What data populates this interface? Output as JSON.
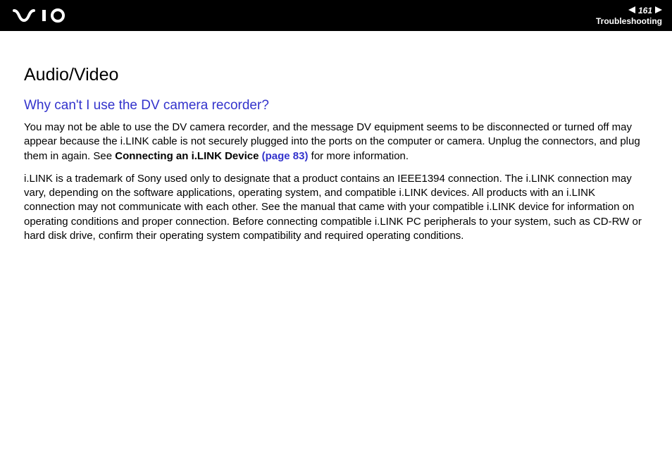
{
  "header": {
    "logo_alt": "VAIO",
    "page_number": "161",
    "section": "Troubleshooting"
  },
  "content": {
    "section_title": "Audio/Video",
    "question": "Why can't I use the DV camera recorder?",
    "p1_a": "You may not be able to use the DV camera recorder, and the message DV equipment seems to be disconnected or turned off may appear because the i.LINK cable is not securely plugged into the ports on the computer or camera. Unplug the connectors, and plug them in again. See ",
    "p1_xref_bold": "Connecting an i.LINK Device",
    "p1_xref_link": " (page 83)",
    "p1_b": " for more information.",
    "p2": "i.LINK is a trademark of Sony used only to designate that a product contains an IEEE1394 connection. The i.LINK connection may vary, depending on the software applications, operating system, and compatible i.LINK devices. All products with an i.LINK connection may not communicate with each other. See the manual that came with your compatible i.LINK device for information on operating conditions and proper connection. Before connecting compatible i.LINK PC peripherals to your system, such as CD-RW or hard disk drive, confirm their operating system compatibility and required operating conditions."
  }
}
